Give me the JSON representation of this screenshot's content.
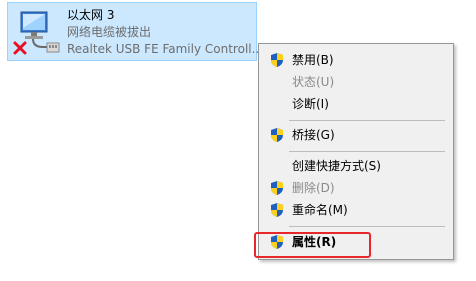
{
  "adapter": {
    "name": "以太网 3",
    "status": "网络电缆被拔出",
    "device": "Realtek USB FE Family Controll..."
  },
  "context_menu": {
    "items": [
      {
        "label": "禁用(B)",
        "shield": true,
        "disabled": false,
        "bold": false
      },
      {
        "label": "状态(U)",
        "shield": false,
        "disabled": true,
        "bold": false
      },
      {
        "label": "诊断(I)",
        "shield": false,
        "disabled": false,
        "bold": false
      },
      {
        "label": "桥接(G)",
        "shield": true,
        "disabled": false,
        "bold": false
      },
      {
        "label": "创建快捷方式(S)",
        "shield": false,
        "disabled": false,
        "bold": false
      },
      {
        "label": "删除(D)",
        "shield": true,
        "disabled": true,
        "bold": false
      },
      {
        "label": "重命名(M)",
        "shield": true,
        "disabled": false,
        "bold": false
      },
      {
        "label": "属性(R)",
        "shield": true,
        "disabled": false,
        "bold": true
      }
    ]
  },
  "colors": {
    "selection_background": "#cce8ff",
    "menu_background": "#f0f0f0",
    "highlight_outline": "#e8272c",
    "disconnected_x": "#e81123"
  }
}
